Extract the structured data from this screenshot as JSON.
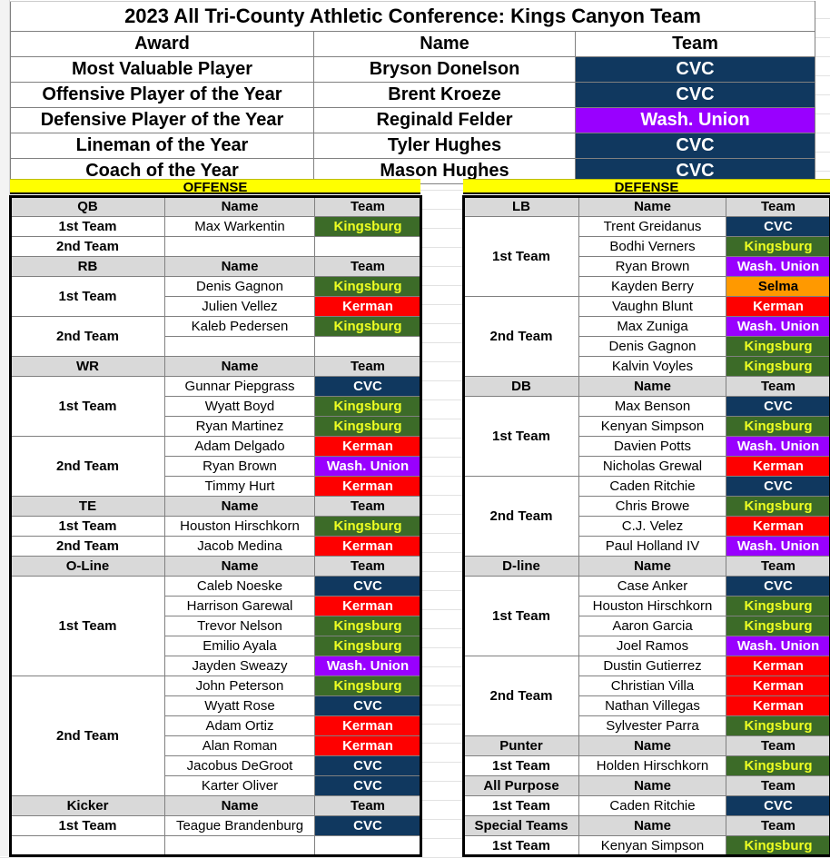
{
  "title": "2023 All Tri-County Athletic Conference: Kings Canyon Team",
  "colors": {
    "cvc": "#10385f",
    "wash_union": "#9900ff",
    "kingsburg": "#3c6b28",
    "kerman": "#fe0000",
    "selma": "#ff9900",
    "banner": "#ffff00",
    "position_header": "#d9d9d9"
  },
  "awards": {
    "headers": [
      "Award",
      "Name",
      "Team"
    ],
    "rows": [
      {
        "award": "Most Valuable Player",
        "name": "Bryson Donelson",
        "team": "CVC",
        "team_key": "cvc"
      },
      {
        "award": "Offensive Player of the Year",
        "name": "Brent Kroeze",
        "team": "CVC",
        "team_key": "cvc"
      },
      {
        "award": "Defensive Player of the Year",
        "name": "Reginald Felder",
        "team": "Wash. Union",
        "team_key": "wash"
      },
      {
        "award": "Lineman of the Year",
        "name": "Tyler Hughes",
        "team": "CVC",
        "team_key": "cvc"
      },
      {
        "award": "Coach of the Year",
        "name": "Mason Hughes",
        "team": "CVC",
        "team_key": "cvc"
      }
    ]
  },
  "offense": {
    "banner": "OFFENSE",
    "col_name": "Name",
    "col_team": "Team",
    "groups": [
      {
        "position": "QB",
        "teams": [
          {
            "label": "1st Team",
            "players": [
              {
                "name": "Max Warkentin",
                "team": "Kingsburg",
                "team_key": "king"
              }
            ]
          },
          {
            "label": "2nd Team",
            "players": [
              {
                "name": "",
                "team": "",
                "team_key": "none"
              }
            ]
          }
        ]
      },
      {
        "position": "RB",
        "teams": [
          {
            "label": "1st Team",
            "players": [
              {
                "name": "Denis Gagnon",
                "team": "Kingsburg",
                "team_key": "king"
              },
              {
                "name": "Julien Vellez",
                "team": "Kerman",
                "team_key": "kerman"
              }
            ]
          },
          {
            "label": "2nd Team",
            "players": [
              {
                "name": "Kaleb Pedersen",
                "team": "Kingsburg",
                "team_key": "king"
              },
              {
                "name": "",
                "team": "",
                "team_key": "none"
              }
            ]
          }
        ]
      },
      {
        "position": "WR",
        "teams": [
          {
            "label": "1st Team",
            "players": [
              {
                "name": "Gunnar Piepgrass",
                "team": "CVC",
                "team_key": "cvc"
              },
              {
                "name": "Wyatt Boyd",
                "team": "Kingsburg",
                "team_key": "king"
              },
              {
                "name": "Ryan Martinez",
                "team": "Kingsburg",
                "team_key": "king"
              }
            ]
          },
          {
            "label": "2nd Team",
            "players": [
              {
                "name": "Adam Delgado",
                "team": "Kerman",
                "team_key": "kerman"
              },
              {
                "name": "Ryan Brown",
                "team": "Wash. Union",
                "team_key": "wash"
              },
              {
                "name": "Timmy Hurt",
                "team": "Kerman",
                "team_key": "kerman"
              }
            ]
          }
        ]
      },
      {
        "position": "TE",
        "teams": [
          {
            "label": "1st Team",
            "players": [
              {
                "name": "Houston Hirschkorn",
                "team": "Kingsburg",
                "team_key": "king"
              }
            ]
          },
          {
            "label": "2nd Team",
            "players": [
              {
                "name": "Jacob Medina",
                "team": "Kerman",
                "team_key": "kerman"
              }
            ]
          }
        ]
      },
      {
        "position": "O-Line",
        "teams": [
          {
            "label": "1st Team",
            "players": [
              {
                "name": "Caleb Noeske",
                "team": "CVC",
                "team_key": "cvc"
              },
              {
                "name": "Harrison Garewal",
                "team": "Kerman",
                "team_key": "kerman"
              },
              {
                "name": "Trevor Nelson",
                "team": "Kingsburg",
                "team_key": "king"
              },
              {
                "name": "Emilio Ayala",
                "team": "Kingsburg",
                "team_key": "king"
              },
              {
                "name": "Jayden Sweazy",
                "team": "Wash. Union",
                "team_key": "wash"
              }
            ]
          },
          {
            "label": "2nd Team",
            "players": [
              {
                "name": "John Peterson",
                "team": "Kingsburg",
                "team_key": "king"
              },
              {
                "name": "Wyatt Rose",
                "team": "CVC",
                "team_key": "cvc"
              },
              {
                "name": "Adam Ortiz",
                "team": "Kerman",
                "team_key": "kerman"
              },
              {
                "name": "Alan Roman",
                "team": "Kerman",
                "team_key": "kerman"
              },
              {
                "name": "Jacobus DeGroot",
                "team": "CVC",
                "team_key": "cvc"
              },
              {
                "name": "Karter Oliver",
                "team": "CVC",
                "team_key": "cvc"
              }
            ]
          }
        ]
      },
      {
        "position": "Kicker",
        "teams": [
          {
            "label": "1st Team",
            "players": [
              {
                "name": "Teague Brandenburg",
                "team": "CVC",
                "team_key": "cvc"
              }
            ]
          },
          {
            "label": "",
            "players": [
              {
                "name": "",
                "team": "",
                "team_key": "none"
              }
            ]
          }
        ]
      }
    ]
  },
  "defense": {
    "banner": "DEFENSE",
    "col_name": "Name",
    "col_team": "Team",
    "groups": [
      {
        "position": "LB",
        "teams": [
          {
            "label": "1st Team",
            "players": [
              {
                "name": "Trent Greidanus",
                "team": "CVC",
                "team_key": "cvc"
              },
              {
                "name": "Bodhi Verners",
                "team": "Kingsburg",
                "team_key": "king"
              },
              {
                "name": "Ryan Brown",
                "team": "Wash. Union",
                "team_key": "wash"
              },
              {
                "name": "Kayden Berry",
                "team": "Selma",
                "team_key": "selma"
              }
            ]
          },
          {
            "label": "2nd Team",
            "players": [
              {
                "name": "Vaughn Blunt",
                "team": "Kerman",
                "team_key": "kerman"
              },
              {
                "name": "Max Zuniga",
                "team": "Wash. Union",
                "team_key": "wash"
              },
              {
                "name": "Denis Gagnon",
                "team": "Kingsburg",
                "team_key": "king"
              },
              {
                "name": "Kalvin Voyles",
                "team": "Kingsburg",
                "team_key": "king"
              }
            ]
          }
        ]
      },
      {
        "position": "DB",
        "teams": [
          {
            "label": "1st Team",
            "players": [
              {
                "name": "Max Benson",
                "team": "CVC",
                "team_key": "cvc"
              },
              {
                "name": "Kenyan Simpson",
                "team": "Kingsburg",
                "team_key": "king"
              },
              {
                "name": "Davien Potts",
                "team": "Wash. Union",
                "team_key": "wash"
              },
              {
                "name": "Nicholas Grewal",
                "team": "Kerman",
                "team_key": "kerman"
              }
            ]
          },
          {
            "label": "2nd Team",
            "players": [
              {
                "name": "Caden Ritchie",
                "team": "CVC",
                "team_key": "cvc"
              },
              {
                "name": "Chris Browe",
                "team": "Kingsburg",
                "team_key": "king"
              },
              {
                "name": "C.J. Velez",
                "team": "Kerman",
                "team_key": "kerman"
              },
              {
                "name": "Paul Holland IV",
                "team": "Wash. Union",
                "team_key": "wash"
              }
            ]
          }
        ]
      },
      {
        "position": "D-line",
        "teams": [
          {
            "label": "1st Team",
            "players": [
              {
                "name": "Case Anker",
                "team": "CVC",
                "team_key": "cvc"
              },
              {
                "name": "Houston Hirschkorn",
                "team": "Kingsburg",
                "team_key": "king"
              },
              {
                "name": "Aaron Garcia",
                "team": "Kingsburg",
                "team_key": "king"
              },
              {
                "name": "Joel Ramos",
                "team": "Wash. Union",
                "team_key": "wash"
              }
            ]
          },
          {
            "label": "2nd Team",
            "players": [
              {
                "name": "Dustin Gutierrez",
                "team": "Kerman",
                "team_key": "kerman"
              },
              {
                "name": "Christian Villa",
                "team": "Kerman",
                "team_key": "kerman"
              },
              {
                "name": "Nathan Villegas",
                "team": "Kerman",
                "team_key": "kerman"
              },
              {
                "name": "Sylvester Parra",
                "team": "Kingsburg",
                "team_key": "king"
              }
            ]
          }
        ]
      },
      {
        "position": "Punter",
        "teams": [
          {
            "label": "1st Team",
            "players": [
              {
                "name": "Holden Hirschkorn",
                "team": "Kingsburg",
                "team_key": "king"
              }
            ]
          }
        ]
      },
      {
        "position": "All Purpose",
        "teams": [
          {
            "label": "1st Team",
            "players": [
              {
                "name": "Caden Ritchie",
                "team": "CVC",
                "team_key": "cvc"
              }
            ]
          }
        ]
      },
      {
        "position": "Special Teams",
        "teams": [
          {
            "label": "1st Team",
            "players": [
              {
                "name": "Kenyan Simpson",
                "team": "Kingsburg",
                "team_key": "king"
              }
            ]
          }
        ]
      }
    ]
  }
}
